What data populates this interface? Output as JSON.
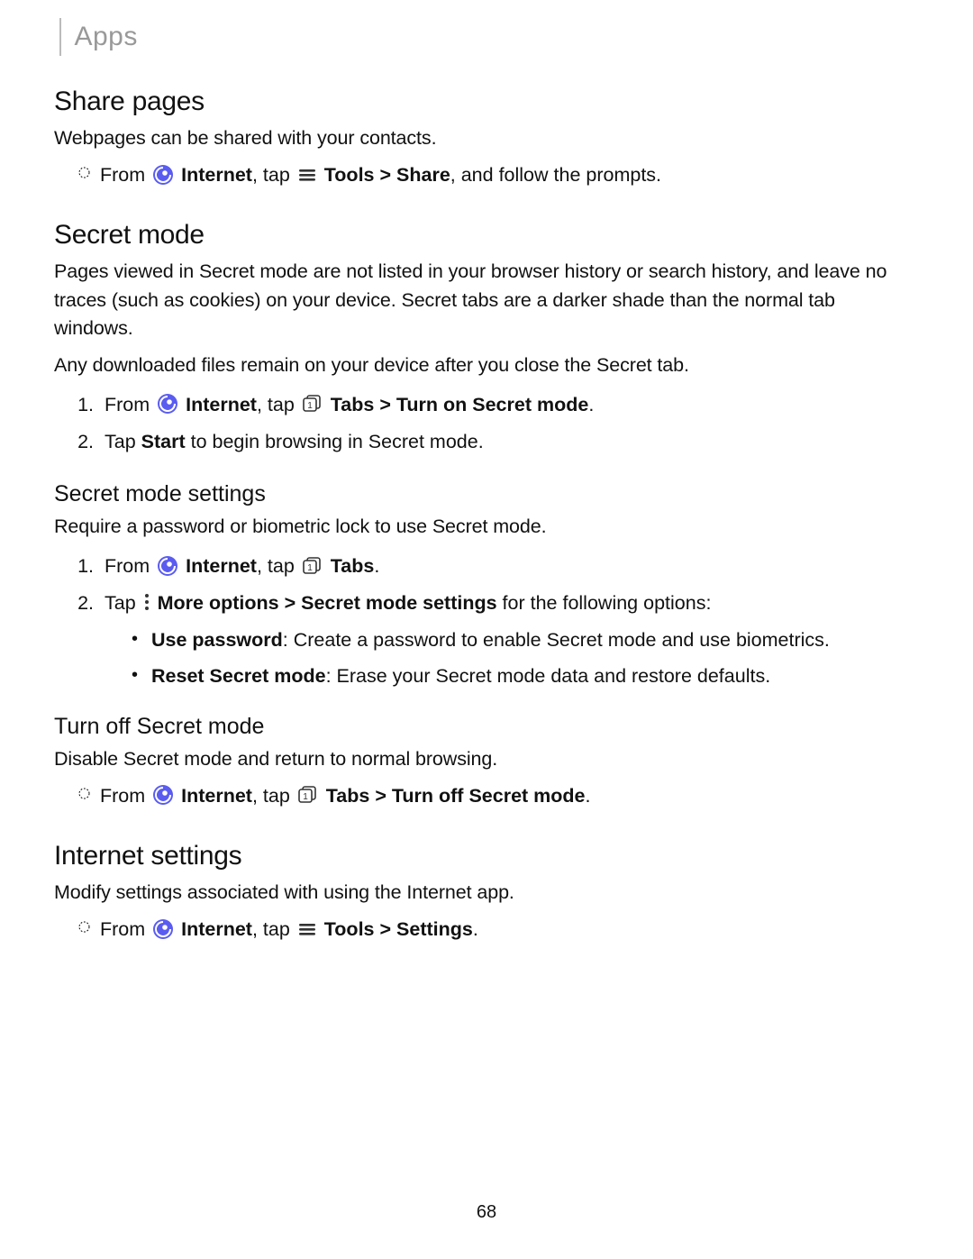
{
  "header": {
    "title": "Apps"
  },
  "sections": {
    "share": {
      "heading": "Share pages",
      "intro": "Webpages can be shared with your contacts.",
      "step_from": "From ",
      "internet": "Internet",
      "tap": ", tap ",
      "tools": "Tools",
      "gt": " > ",
      "share": "Share",
      "tail": ", and follow the prompts."
    },
    "secret": {
      "heading": "Secret mode",
      "p1": "Pages viewed in Secret mode are not listed in your browser history or search history, and leave no traces (such as cookies) on your device. Secret tabs are a darker shade than the normal tab windows.",
      "p2": "Any downloaded files remain on your device after you close the Secret tab.",
      "ol1": {
        "from": "From ",
        "internet": "Internet",
        "tap": ", tap ",
        "tabs": "Tabs",
        "gt": " > ",
        "turn_on": "Turn on Secret mode",
        "end": "."
      },
      "ol2_pre": "Tap ",
      "ol2_start": "Start",
      "ol2_post": " to begin browsing in Secret mode."
    },
    "secret_settings": {
      "heading": "Secret mode settings",
      "intro": "Require a password or biometric lock to use Secret mode.",
      "ol1": {
        "from": "From ",
        "internet": "Internet",
        "tap": ", tap ",
        "tabs": "Tabs",
        "end": "."
      },
      "ol2": {
        "tap": "Tap ",
        "more": "More options",
        "gt": " > ",
        "sms": "Secret mode settings",
        "tail": " for the following options:"
      },
      "bullets": {
        "b1_label": "Use password",
        "b1_text": ": Create a password to enable Secret mode and use biometrics.",
        "b2_label": "Reset Secret mode",
        "b2_text": ": Erase your Secret mode data and restore defaults."
      }
    },
    "turn_off": {
      "heading": "Turn off Secret mode",
      "intro": "Disable Secret mode and return to normal browsing.",
      "step": {
        "from": "From ",
        "internet": "Internet",
        "tap": ", tap ",
        "tabs": "Tabs",
        "gt": " > ",
        "turn_off": "Turn off Secret mode",
        "end": "."
      }
    },
    "internet_settings": {
      "heading": "Internet settings",
      "intro": "Modify settings associated with using the Internet app.",
      "step": {
        "from": "From ",
        "internet": "Internet",
        "tap": ", tap ",
        "tools": "Tools",
        "gt": " > ",
        "settings": "Settings",
        "end": "."
      }
    }
  },
  "footer": {
    "page_number": "68"
  }
}
